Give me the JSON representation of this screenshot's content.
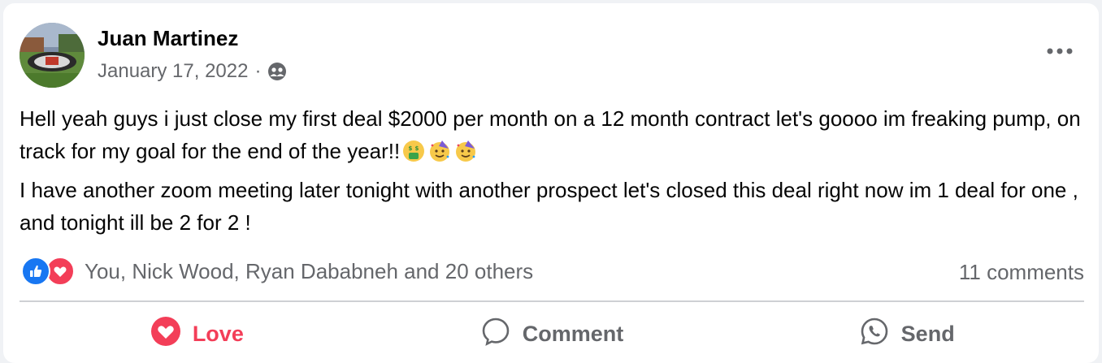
{
  "post": {
    "author": "Juan Martinez",
    "date": "January 17, 2022",
    "separator": "·",
    "audience_icon": "friends-icon",
    "more_icon": "more-options-icon",
    "paragraphs": [
      "Hell yeah guys i just close my first deal $2000 per month on a 12 month contract let's goooo  im freaking pump, on track for my goal for the end of the year!!",
      "I have another zoom meeting later tonight with another prospect let's closed this deal right now im 1 deal for one , and tonight ill be 2 for 2 !"
    ],
    "emojis": [
      "money-mouth-face-emoji",
      "partying-face-emoji",
      "partying-face-emoji"
    ]
  },
  "reactions": {
    "icons": [
      "like-icon",
      "love-icon"
    ],
    "summary": "You, Nick Wood, Ryan Dababneh and 20 others",
    "comments": "11 comments"
  },
  "actions": {
    "love_label": "Love",
    "comment_label": "Comment",
    "send_label": "Send"
  },
  "colors": {
    "love": "#f33e58",
    "like": "#1877f2",
    "secondary_text": "#65676b"
  }
}
